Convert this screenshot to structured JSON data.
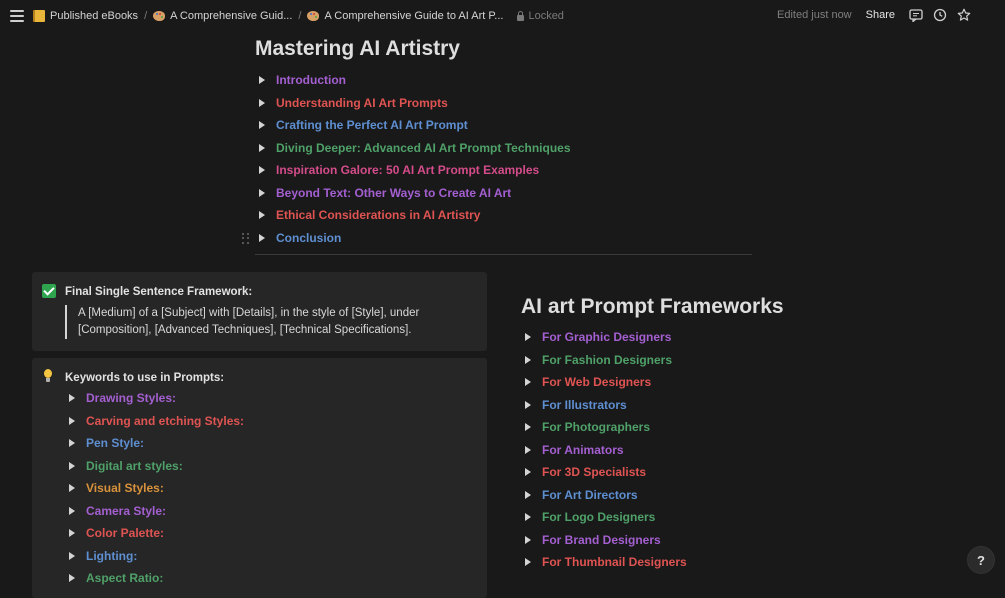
{
  "breadcrumb": {
    "items": [
      {
        "label": "Published eBooks",
        "icon": "book-icon"
      },
      {
        "label": "A Comprehensive Guid...",
        "icon": "palette-icon"
      },
      {
        "label": "A Comprehensive Guide to AI Art P...",
        "icon": "palette-icon"
      }
    ],
    "separator": "/",
    "lock_label": "Locked"
  },
  "toolbar": {
    "edited": "Edited just now",
    "share": "Share"
  },
  "toc": {
    "title": "Mastering AI Artistry",
    "items": [
      {
        "label": "Introduction",
        "color": "#a45fd1"
      },
      {
        "label": "Understanding AI Art Prompts",
        "color": "#df5452"
      },
      {
        "label": "Crafting the Perfect AI Art Prompt",
        "color": "#5e8fd1"
      },
      {
        "label": "Diving Deeper: Advanced AI Art Prompt Techniques",
        "color": "#4fa169"
      },
      {
        "label": "Inspiration Galore: 50 AI Art Prompt Examples",
        "color": "#d44c8a"
      },
      {
        "label": "Beyond Text: Other Ways to Create AI Art",
        "color": "#a45fd1"
      },
      {
        "label": "Ethical Considerations in AI Artistry",
        "color": "#df5452"
      },
      {
        "label": "Conclusion",
        "color": "#5e8fd1"
      }
    ]
  },
  "framework_callout": {
    "title": "Final Single Sentence Framework:",
    "quote": "A [Medium] of a [Subject] with [Details], in the style of [Style], under [Composition], [Advanced Techniques], [Technical Specifications]."
  },
  "keywords_callout": {
    "title": "Keywords to use in Prompts:",
    "items": [
      {
        "label": "Drawing Styles:",
        "color": "#a45fd1"
      },
      {
        "label": "Carving and etching Styles:",
        "color": "#df5452"
      },
      {
        "label": "Pen Style:",
        "color": "#5e8fd1"
      },
      {
        "label": "Digital art styles:",
        "color": "#4fa169"
      },
      {
        "label": "Visual Styles:",
        "color": "#d9923c"
      },
      {
        "label": "Camera Style:",
        "color": "#a45fd1"
      },
      {
        "label": "Color Palette:",
        "color": "#df5452"
      },
      {
        "label": "Lighting:",
        "color": "#5e8fd1"
      },
      {
        "label": "Aspect Ratio:",
        "color": "#4fa169"
      }
    ]
  },
  "frameworks": {
    "title": "AI art Prompt Frameworks",
    "items": [
      {
        "label": "For Graphic Designers",
        "color": "#a45fd1"
      },
      {
        "label": "For Fashion Designers",
        "color": "#4fa169"
      },
      {
        "label": "For Web Designers",
        "color": "#df5452"
      },
      {
        "label": "For Illustrators",
        "color": "#5e8fd1"
      },
      {
        "label": "For Photographers",
        "color": "#4fa169"
      },
      {
        "label": "For Animators",
        "color": "#a45fd1"
      },
      {
        "label": "For 3D Specialists",
        "color": "#df5452"
      },
      {
        "label": "For Art Directors",
        "color": "#5e8fd1"
      },
      {
        "label": "For Logo Designers",
        "color": "#4fa169"
      },
      {
        "label": "For Brand Designers",
        "color": "#a45fd1"
      },
      {
        "label": "For Thumbnail Designers",
        "color": "#df5452"
      }
    ]
  },
  "help": {
    "label": "?"
  }
}
